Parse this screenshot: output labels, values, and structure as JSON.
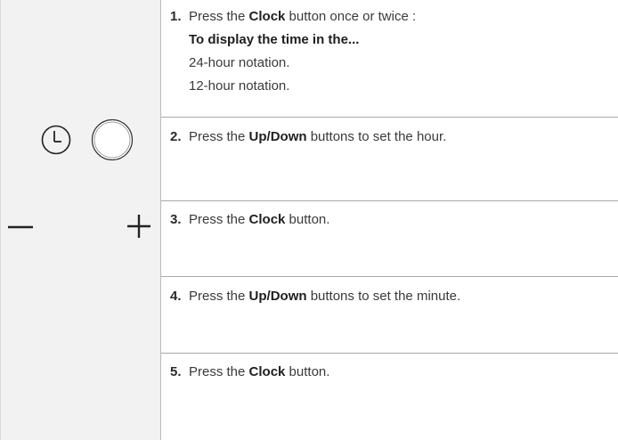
{
  "steps": [
    {
      "number": "1.",
      "pre": "Press the ",
      "bold": "Clock",
      "post": " button once or twice :",
      "sub_heading": "To display the time in the...",
      "sub_items": [
        "24-hour notation.",
        "12-hour notation."
      ]
    },
    {
      "number": "2.",
      "pre": "Press the ",
      "bold": "Up/Down",
      "post": " buttons to set the hour."
    },
    {
      "number": "3.",
      "pre": "Press the ",
      "bold": "Clock",
      "post": " button."
    },
    {
      "number": "4.",
      "pre": "Press the ",
      "bold": "Up/Down",
      "post": " buttons to set the minute."
    },
    {
      "number": "5.",
      "pre": "Press the ",
      "bold": "Clock",
      "post": " button."
    }
  ],
  "icons": [
    "clock-icon",
    "round-button-icon",
    "minus-icon",
    "plus-icon"
  ]
}
